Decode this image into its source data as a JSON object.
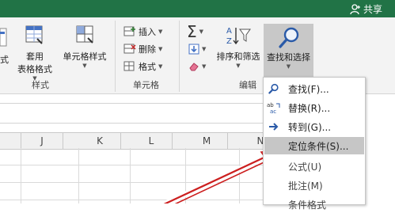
{
  "title_bar": {
    "share_label": "共享",
    "color": "#217346"
  },
  "ribbon": {
    "styles_group": {
      "label": "样式",
      "conditional_format_partial": "式",
      "table_format": "套用\n表格格式",
      "table_format_line1": "套用",
      "table_format_line2": "表格格式",
      "cell_styles": "单元格样式"
    },
    "cells_group": {
      "label": "单元格",
      "insert": "插入",
      "delete": "删除",
      "format": "格式"
    },
    "editing_group": {
      "label": "编辑",
      "sort_filter": "排序和筛选",
      "find_select": "查找和选择"
    }
  },
  "sheet": {
    "columns": [
      "J",
      "K",
      "L",
      "M",
      "N"
    ]
  },
  "find_menu": {
    "items": [
      {
        "label": "查找(F)...",
        "icon": "search-icon"
      },
      {
        "label": "替换(R)...",
        "icon": "replace-icon"
      },
      {
        "label": "转到(G)...",
        "icon": "arrow-right-icon"
      },
      {
        "label": "定位条件(S)...",
        "icon": "none",
        "highlighted": true
      },
      {
        "label": "公式(U)",
        "icon": "none"
      },
      {
        "label": "批注(M)",
        "icon": "none"
      },
      {
        "label": "条件格式",
        "icon": "none"
      }
    ]
  },
  "annotation": {
    "arrow_color": "#cc1f1f"
  }
}
